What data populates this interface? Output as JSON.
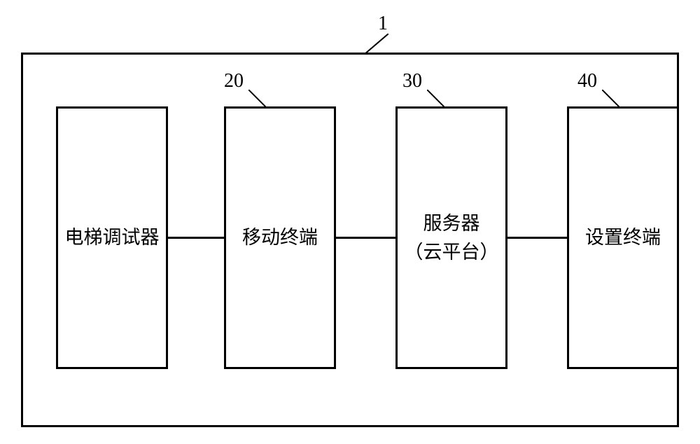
{
  "labels": {
    "container": "1",
    "box2_ref": "20",
    "box3_ref": "30",
    "box4_ref": "40"
  },
  "boxes": {
    "b1": "电梯调试器",
    "b2": "移动终端",
    "b3_line1": "服务器",
    "b3_line2": "（云平台）",
    "b4": "设置终端"
  }
}
